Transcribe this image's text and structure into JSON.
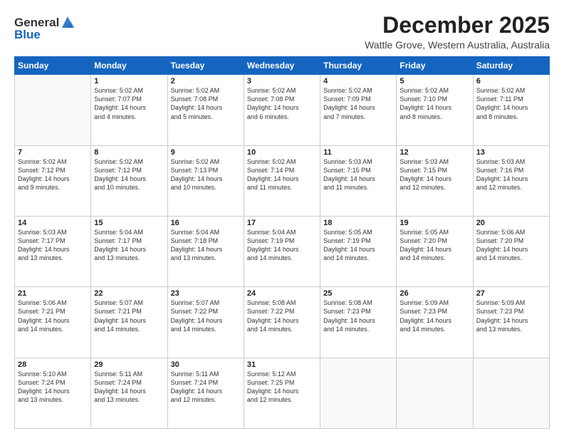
{
  "app": {
    "logo_line1": "General",
    "logo_line2": "Blue"
  },
  "title": "December 2025",
  "location": "Wattle Grove, Western Australia, Australia",
  "header_days": [
    "Sunday",
    "Monday",
    "Tuesday",
    "Wednesday",
    "Thursday",
    "Friday",
    "Saturday"
  ],
  "weeks": [
    [
      {
        "day": "",
        "info": ""
      },
      {
        "day": "1",
        "info": "Sunrise: 5:02 AM\nSunset: 7:07 PM\nDaylight: 14 hours\nand 4 minutes."
      },
      {
        "day": "2",
        "info": "Sunrise: 5:02 AM\nSunset: 7:08 PM\nDaylight: 14 hours\nand 5 minutes."
      },
      {
        "day": "3",
        "info": "Sunrise: 5:02 AM\nSunset: 7:08 PM\nDaylight: 14 hours\nand 6 minutes."
      },
      {
        "day": "4",
        "info": "Sunrise: 5:02 AM\nSunset: 7:09 PM\nDaylight: 14 hours\nand 7 minutes."
      },
      {
        "day": "5",
        "info": "Sunrise: 5:02 AM\nSunset: 7:10 PM\nDaylight: 14 hours\nand 8 minutes."
      },
      {
        "day": "6",
        "info": "Sunrise: 5:02 AM\nSunset: 7:11 PM\nDaylight: 14 hours\nand 8 minutes."
      }
    ],
    [
      {
        "day": "7",
        "info": "Sunrise: 5:02 AM\nSunset: 7:12 PM\nDaylight: 14 hours\nand 9 minutes."
      },
      {
        "day": "8",
        "info": "Sunrise: 5:02 AM\nSunset: 7:12 PM\nDaylight: 14 hours\nand 10 minutes."
      },
      {
        "day": "9",
        "info": "Sunrise: 5:02 AM\nSunset: 7:13 PM\nDaylight: 14 hours\nand 10 minutes."
      },
      {
        "day": "10",
        "info": "Sunrise: 5:02 AM\nSunset: 7:14 PM\nDaylight: 14 hours\nand 11 minutes."
      },
      {
        "day": "11",
        "info": "Sunrise: 5:03 AM\nSunset: 7:15 PM\nDaylight: 14 hours\nand 11 minutes."
      },
      {
        "day": "12",
        "info": "Sunrise: 5:03 AM\nSunset: 7:15 PM\nDaylight: 14 hours\nand 12 minutes."
      },
      {
        "day": "13",
        "info": "Sunrise: 5:03 AM\nSunset: 7:16 PM\nDaylight: 14 hours\nand 12 minutes."
      }
    ],
    [
      {
        "day": "14",
        "info": "Sunrise: 5:03 AM\nSunset: 7:17 PM\nDaylight: 14 hours\nand 13 minutes."
      },
      {
        "day": "15",
        "info": "Sunrise: 5:04 AM\nSunset: 7:17 PM\nDaylight: 14 hours\nand 13 minutes."
      },
      {
        "day": "16",
        "info": "Sunrise: 5:04 AM\nSunset: 7:18 PM\nDaylight: 14 hours\nand 13 minutes."
      },
      {
        "day": "17",
        "info": "Sunrise: 5:04 AM\nSunset: 7:19 PM\nDaylight: 14 hours\nand 14 minutes."
      },
      {
        "day": "18",
        "info": "Sunrise: 5:05 AM\nSunset: 7:19 PM\nDaylight: 14 hours\nand 14 minutes."
      },
      {
        "day": "19",
        "info": "Sunrise: 5:05 AM\nSunset: 7:20 PM\nDaylight: 14 hours\nand 14 minutes."
      },
      {
        "day": "20",
        "info": "Sunrise: 5:06 AM\nSunset: 7:20 PM\nDaylight: 14 hours\nand 14 minutes."
      }
    ],
    [
      {
        "day": "21",
        "info": "Sunrise: 5:06 AM\nSunset: 7:21 PM\nDaylight: 14 hours\nand 14 minutes."
      },
      {
        "day": "22",
        "info": "Sunrise: 5:07 AM\nSunset: 7:21 PM\nDaylight: 14 hours\nand 14 minutes."
      },
      {
        "day": "23",
        "info": "Sunrise: 5:07 AM\nSunset: 7:22 PM\nDaylight: 14 hours\nand 14 minutes."
      },
      {
        "day": "24",
        "info": "Sunrise: 5:08 AM\nSunset: 7:22 PM\nDaylight: 14 hours\nand 14 minutes."
      },
      {
        "day": "25",
        "info": "Sunrise: 5:08 AM\nSunset: 7:23 PM\nDaylight: 14 hours\nand 14 minutes."
      },
      {
        "day": "26",
        "info": "Sunrise: 5:09 AM\nSunset: 7:23 PM\nDaylight: 14 hours\nand 14 minutes."
      },
      {
        "day": "27",
        "info": "Sunrise: 5:09 AM\nSunset: 7:23 PM\nDaylight: 14 hours\nand 13 minutes."
      }
    ],
    [
      {
        "day": "28",
        "info": "Sunrise: 5:10 AM\nSunset: 7:24 PM\nDaylight: 14 hours\nand 13 minutes."
      },
      {
        "day": "29",
        "info": "Sunrise: 5:11 AM\nSunset: 7:24 PM\nDaylight: 14 hours\nand 13 minutes."
      },
      {
        "day": "30",
        "info": "Sunrise: 5:11 AM\nSunset: 7:24 PM\nDaylight: 14 hours\nand 12 minutes."
      },
      {
        "day": "31",
        "info": "Sunrise: 5:12 AM\nSunset: 7:25 PM\nDaylight: 14 hours\nand 12 minutes."
      },
      {
        "day": "",
        "info": ""
      },
      {
        "day": "",
        "info": ""
      },
      {
        "day": "",
        "info": ""
      }
    ]
  ]
}
